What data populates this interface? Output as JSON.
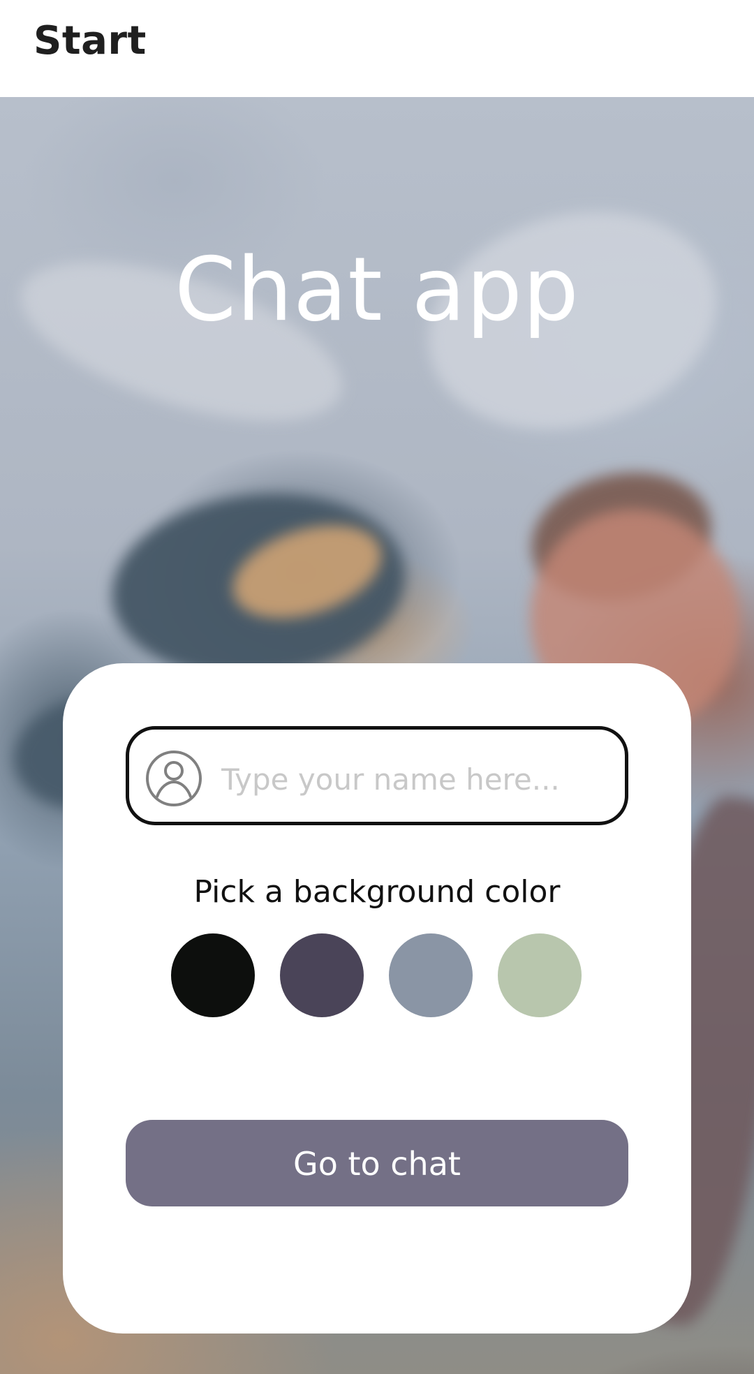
{
  "appbar": {
    "title": "Start"
  },
  "hero": {
    "title": "Chat app"
  },
  "form": {
    "name_placeholder": "Type your name here...",
    "background_label": "Pick a background color",
    "button_label": "Go to chat"
  },
  "colors": [
    {
      "name": "black",
      "hex": "#0d0f0d"
    },
    {
      "name": "purple",
      "hex": "#4a4458"
    },
    {
      "name": "gray-blue",
      "hex": "#8a95a5"
    },
    {
      "name": "green",
      "hex": "#b8c6ad"
    }
  ],
  "theme": {
    "button_color": "#747086",
    "text_dark": "#111111",
    "placeholder_color": "#c8c8c8"
  },
  "icons": {
    "avatar": "person-icon"
  }
}
